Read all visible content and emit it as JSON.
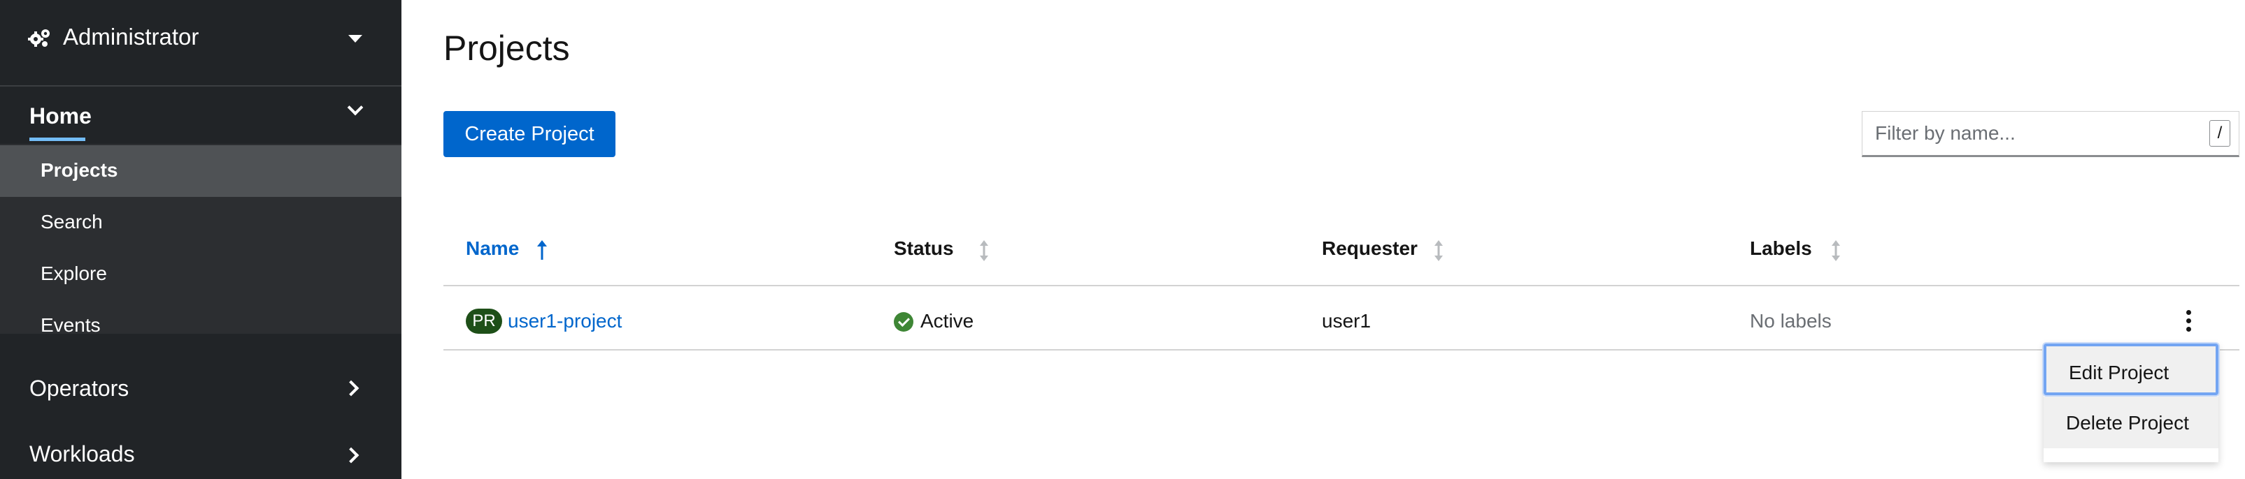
{
  "perspective": {
    "title": "Administrator",
    "icon": "gears-icon"
  },
  "sidebar": {
    "home": {
      "label": "Home",
      "items": [
        {
          "label": "Projects",
          "active": true
        },
        {
          "label": "Search"
        },
        {
          "label": "Explore"
        },
        {
          "label": "Events"
        }
      ]
    },
    "sections": [
      {
        "label": "Operators"
      },
      {
        "label": "Workloads"
      }
    ]
  },
  "page": {
    "title": "Projects"
  },
  "toolbar": {
    "create_label": "Create Project",
    "filter_placeholder": "Filter by name...",
    "filter_shortcut": "/"
  },
  "table": {
    "columns": [
      "Name",
      "Status",
      "Requester",
      "Labels"
    ],
    "rows": [
      {
        "badge": "PR",
        "name": "user1-project",
        "status": "Active",
        "requester": "user1",
        "labels": "No labels"
      }
    ]
  },
  "menu": {
    "items": [
      "Edit Project",
      "Delete Project"
    ]
  },
  "colors": {
    "accent": "#0066cc",
    "sidebar": "#212427",
    "status_active": "#3e8635",
    "badge": "#1e4f18"
  }
}
